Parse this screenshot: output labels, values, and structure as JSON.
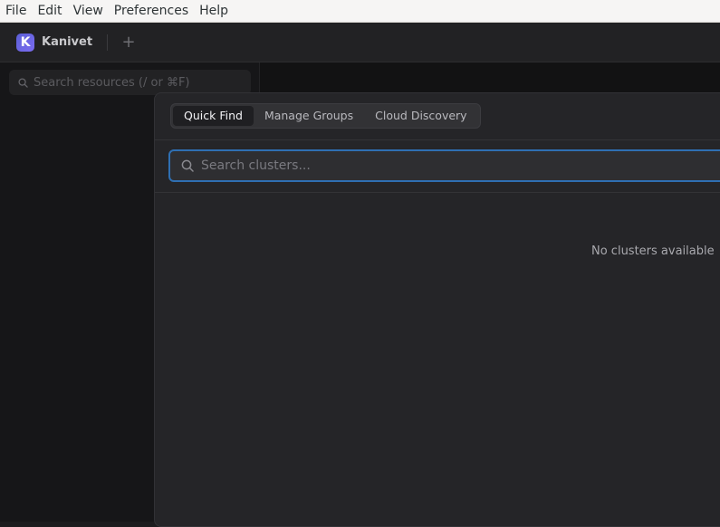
{
  "menubar": {
    "items": [
      "File",
      "Edit",
      "View",
      "Preferences",
      "Help"
    ]
  },
  "titlebar": {
    "logo_letter": "K",
    "app_name": "Kanivet",
    "add_tab_symbol": "+"
  },
  "sidebar": {
    "search_placeholder": "Search resources (/ or ⌘F)",
    "search_icon": "search-icon"
  },
  "modal": {
    "tabs": [
      {
        "label": "Quick Find",
        "active": true
      },
      {
        "label": "Manage Groups",
        "active": false
      },
      {
        "label": "Cloud Discovery",
        "active": false
      }
    ],
    "search_placeholder": "Search clusters...",
    "search_value": "",
    "empty_message": "No clusters available"
  },
  "colors": {
    "accent_focus": "#2f6fb2",
    "logo_bg": "#5b5fd6",
    "modal_bg": "#252528",
    "app_bg": "#1c1c1e"
  }
}
